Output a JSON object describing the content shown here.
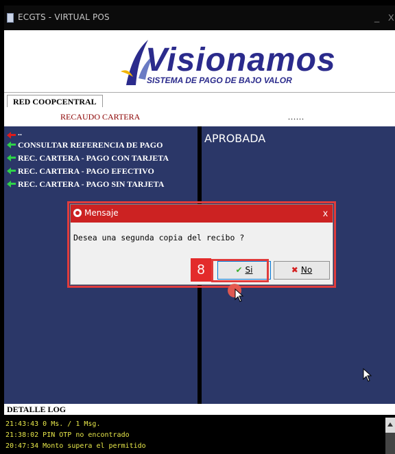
{
  "window": {
    "title": "ECGTS - VIRTUAL POS",
    "min_glyph": "_",
    "close_glyph": "X"
  },
  "banner": {
    "brand": "Visionamos",
    "tagline": "SISTEMA DE PAGO DE BAJO VALOR"
  },
  "tab": {
    "label": "RED COOPCENTRAL"
  },
  "subheader": {
    "title": "RECAUDO CARTERA",
    "dots": "......"
  },
  "menu": {
    "back_label": "..",
    "items": [
      {
        "label": "CONSULTAR REFERENCIA DE PAGO"
      },
      {
        "label": "REC. CARTERA - PAGO CON TARJETA"
      },
      {
        "label": "REC. CARTERA - PAGO EFECTIVO"
      },
      {
        "label": "REC. CARTERA - PAGO SIN TARJETA"
      }
    ]
  },
  "status": {
    "text": "APROBADA"
  },
  "dialog": {
    "title": "Mensaje",
    "close_glyph": "x",
    "message": "Desea una segunda copia del recibo ?",
    "yes_label": "Si",
    "no_label": "No",
    "yes_mark": "✔",
    "no_mark": "✖"
  },
  "annotation": {
    "step": "8"
  },
  "log": {
    "title": "DETALLE LOG",
    "lines": [
      "21:43:43 0 Ms. / 1 Msg.",
      "21:38:02 PIN OTP no encontrado",
      "20:47:34 Monto supera el permitido"
    ]
  },
  "colors": {
    "panel": "#2b3768",
    "accent_red": "#e03c3c",
    "dialog_title": "#cc2222",
    "log_text": "#e8e84a",
    "brand_blue": "#2b2b8c"
  }
}
